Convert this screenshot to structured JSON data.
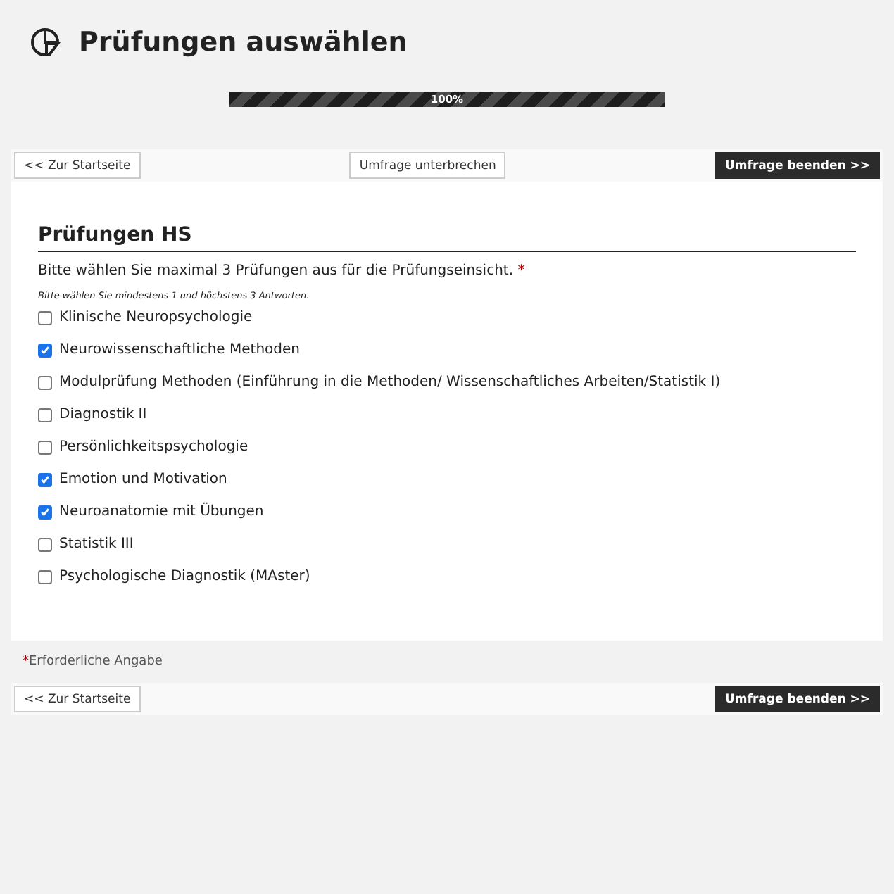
{
  "title": "Prüfungen auswählen",
  "progress": {
    "level": 1,
    "label": "100%"
  },
  "nav_top": {
    "home": "<< Zur Startseite",
    "pause": "Umfrage unterbrechen",
    "finish": "Umfrage beenden >>"
  },
  "question": {
    "heading": "Prüfungen HS",
    "text": "Bitte wählen Sie maximal 3 Prüfungen aus für die Prüfungseinsicht.",
    "required_mark": "*",
    "hint": "Bitte wählen Sie mindestens 1 und höchstens 3 Antworten.",
    "options": [
      {
        "label": "Klinische Neuropsychologie",
        "checked": false
      },
      {
        "label": "Neurowissenschaftliche Methoden",
        "checked": true
      },
      {
        "label": "Modulprüfung Methoden (Einführung in die Methoden/ Wissenschaftliches Arbeiten/Statistik I)",
        "checked": false
      },
      {
        "label": "Diagnostik II",
        "checked": false
      },
      {
        "label": "Persönlichkeitspsychologie",
        "checked": false
      },
      {
        "label": "Emotion und Motivation",
        "checked": true
      },
      {
        "label": "Neuroanatomie mit Übungen",
        "checked": true
      },
      {
        "label": "Statistik III",
        "checked": false
      },
      {
        "label": "Psychologische Diagnostik (MAster)",
        "checked": false
      }
    ]
  },
  "required_note": {
    "mark": "*",
    "text": "Erforderliche Angabe"
  },
  "nav_bottom": {
    "home": "<< Zur Startseite",
    "finish": "Umfrage beenden >>"
  }
}
